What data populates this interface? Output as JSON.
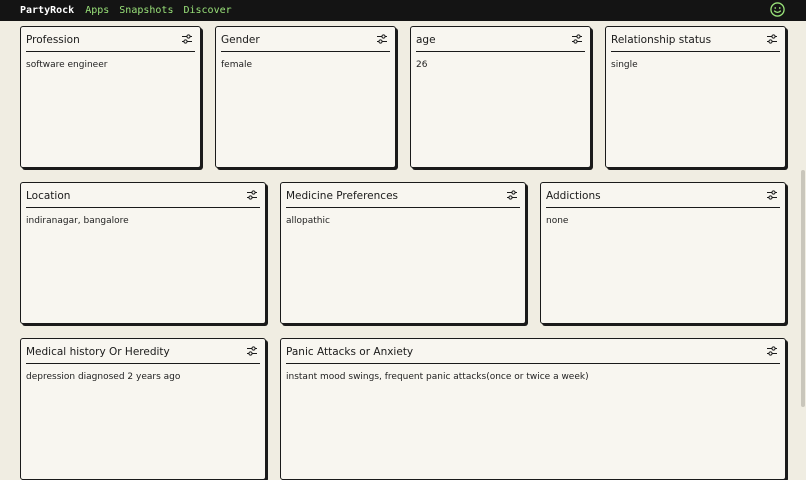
{
  "topbar": {
    "brand": "PartyRock",
    "nav": [
      "Apps",
      "Snapshots",
      "Discover"
    ],
    "avatar_icon": "smiley-face-icon",
    "accent": "#9ae37a"
  },
  "cards": [
    {
      "title": "Profession",
      "value": "software engineer"
    },
    {
      "title": "Gender",
      "value": "female"
    },
    {
      "title": "age",
      "value": "26"
    },
    {
      "title": "Relationship status",
      "value": "single"
    },
    {
      "title": "Location",
      "value": "indiranagar, bangalore"
    },
    {
      "title": "Medicine Preferences",
      "value": "allopathic"
    },
    {
      "title": "Addictions",
      "value": "none"
    },
    {
      "title": "Medical history Or Heredity",
      "value": "depression diagnosed 2 years ago"
    },
    {
      "title": "Panic Attacks or Anxiety",
      "value": "instant mood swings, frequent panic attacks(once or twice a week)"
    }
  ],
  "card_settings_icon": "sliders-icon"
}
